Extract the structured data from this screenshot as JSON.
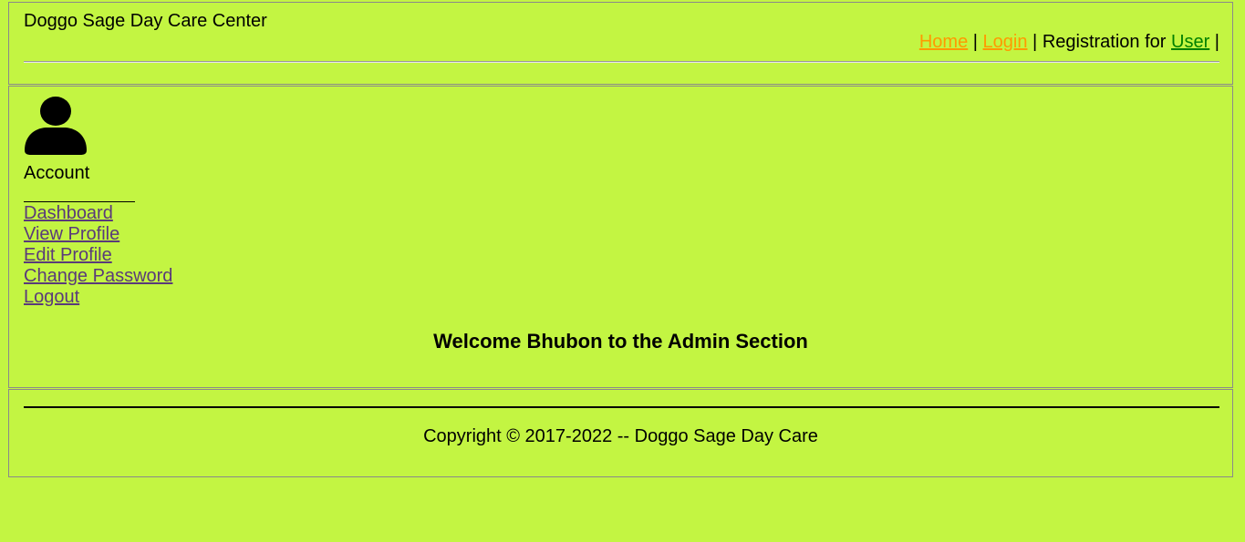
{
  "header": {
    "title": "Doggo Sage Day Care Center",
    "nav": {
      "home": "Home",
      "sep1": "|",
      "login": "Login",
      "sep2": "|",
      "registration_text": "Registration for",
      "user": "User",
      "sep3": "|"
    }
  },
  "sidebar": {
    "avatar_icon": "user-silhouette-icon",
    "account_label": "Account",
    "links": [
      "Dashboard",
      "View Profile",
      "Edit Profile",
      "Change Password",
      "Logout"
    ]
  },
  "main": {
    "welcome": "Welcome Bhubon to the Admin Section"
  },
  "footer": {
    "copyright": "Copyright © 2017-2022 -- Doggo Sage Day Care"
  },
  "colors": {
    "background": "#c3f542",
    "link_orange": "#ff9900",
    "link_green": "#008000",
    "link_visited": "#5a3a7a"
  }
}
